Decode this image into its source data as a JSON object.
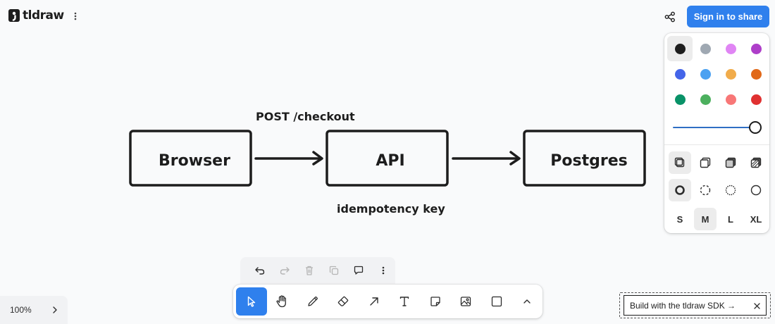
{
  "app": {
    "logo_text": "tldraw"
  },
  "header": {
    "signin_label": "Sign in to share"
  },
  "style_panel": {
    "colors": [
      {
        "name": "black",
        "hex": "#1d1d1d",
        "selected": true
      },
      {
        "name": "grey",
        "hex": "#9fa8b2"
      },
      {
        "name": "light-violet",
        "hex": "#e085f4"
      },
      {
        "name": "violet",
        "hex": "#ae3ec9"
      },
      {
        "name": "blue",
        "hex": "#4465e9"
      },
      {
        "name": "light-blue",
        "hex": "#4ba1f1"
      },
      {
        "name": "yellow",
        "hex": "#f1ac4b"
      },
      {
        "name": "orange",
        "hex": "#e16919"
      },
      {
        "name": "green",
        "hex": "#099268"
      },
      {
        "name": "light-green",
        "hex": "#4cb05e"
      },
      {
        "name": "light-red",
        "hex": "#f87777"
      },
      {
        "name": "red",
        "hex": "#e03131"
      }
    ],
    "opacity": 1.0,
    "sizes": [
      "S",
      "M",
      "L",
      "XL"
    ],
    "selected_size": "M"
  },
  "canvas": {
    "shapes": [
      "Browser",
      "API",
      "Postgres"
    ],
    "arrow_labels": [
      "POST /checkout",
      "idempotency key"
    ]
  },
  "zoom": {
    "label": "100%"
  },
  "sdk_banner": {
    "label": "Build with the tldraw SDK →"
  },
  "toolbar": {
    "tools": [
      "select",
      "hand",
      "draw",
      "eraser",
      "arrow",
      "text",
      "note",
      "asset",
      "rectangle",
      "more"
    ],
    "active_tool": "select"
  },
  "accent": "#2f80ed"
}
